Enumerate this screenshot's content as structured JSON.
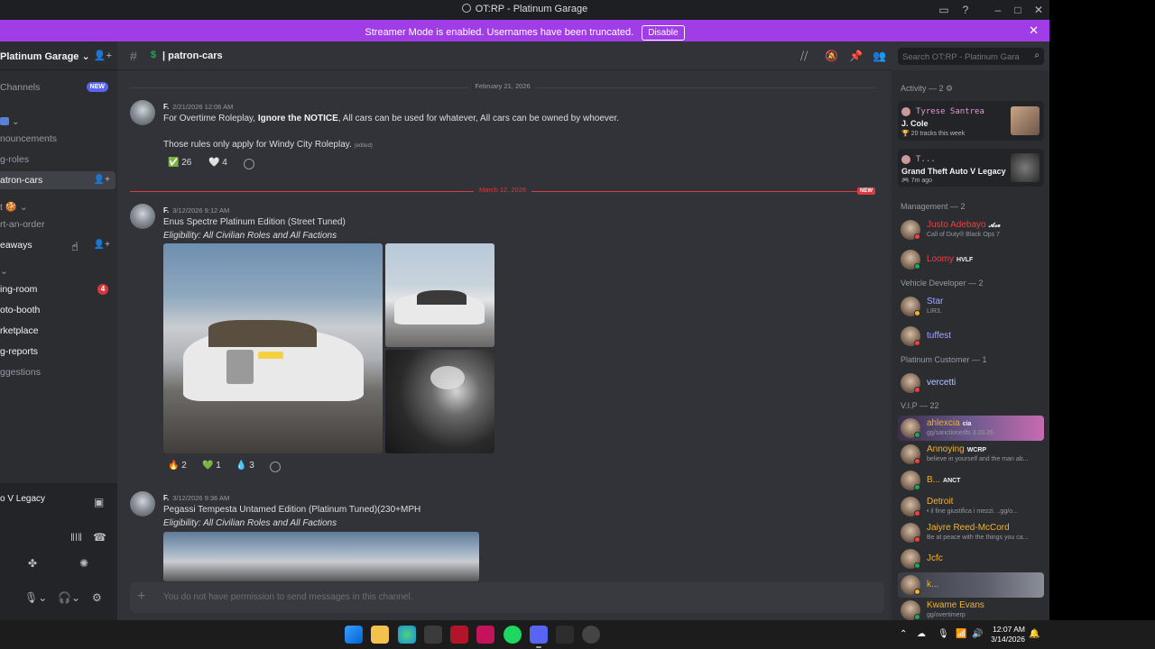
{
  "window": {
    "title": "OT:RP - Platinum Garage"
  },
  "banner": {
    "message": "Streamer Mode is enabled. Usernames have been truncated.",
    "disable_label": "Disable"
  },
  "server": {
    "name": "Platinum Garage"
  },
  "sidebar": {
    "browse_channels": "Channels",
    "new_badge": "NEW",
    "channels": [
      {
        "label": "nouncements"
      },
      {
        "label": "g-roles"
      },
      {
        "label": "atron-cars"
      },
      {
        "label": "rt-an-order"
      },
      {
        "label": "eaways"
      },
      {
        "label": "ing-room",
        "badge": "4"
      },
      {
        "label": "oto-booth"
      },
      {
        "label": "rketplace"
      },
      {
        "label": "g-reports"
      },
      {
        "label": "ggestions"
      }
    ],
    "voice_activity": "o V Legacy"
  },
  "chat": {
    "channel_name": "| patron-cars",
    "search_placeholder": "Search OT:RP - Platinum Garage",
    "composer_placeholder": "You do not have permission to send messages in this channel.",
    "dividers": [
      {
        "label": "February 21, 2026"
      },
      {
        "label": "March 12, 2026",
        "new_tag": "NEW"
      }
    ],
    "messages": [
      {
        "author": "F.",
        "timestamp": "2/21/2026 12:06 AM",
        "line1_pre": "For Overtime Roleplay, ",
        "line1_bold": "Ignore the NOTICE",
        "line1_post": ", All cars can be used for whatever, All cars can be owned by whoever.",
        "line2": "Those rules only apply for Windy City Roleplay.",
        "edited": "(edited)",
        "reactions": [
          {
            "emoji": "✅",
            "count": "26"
          },
          {
            "emoji": "🤍",
            "count": "4"
          }
        ]
      },
      {
        "author": "F.",
        "timestamp": "3/12/2026 9:12 AM",
        "title": "Enus Spectre Platinum Edition (Street Tuned)",
        "subtitle": "Eligibility: All Civilian Roles and All Factions",
        "reactions": [
          {
            "emoji": "🔥",
            "count": "2"
          },
          {
            "emoji": "💚",
            "count": "1"
          },
          {
            "emoji": "💧",
            "count": "3"
          }
        ]
      },
      {
        "author": "F.",
        "timestamp": "3/12/2026 9:36 AM",
        "title": "Pegassi Tempesta Untamed Edition (Platinum Tuned)(230+MPH",
        "subtitle": "Eligibility: All Civilian Roles and All Factions"
      }
    ]
  },
  "members": {
    "activity_header": "Activity — 2",
    "activities": [
      {
        "user": "Tyrese Santrea",
        "title": "J. Cole",
        "sub": "20 tracks this week"
      },
      {
        "user": "T...",
        "title": "Grand Theft Auto V Legacy",
        "sub": "7m ago"
      }
    ],
    "sections": [
      {
        "header": "Management — 2",
        "members": [
          {
            "name": "Justo Adebayo",
            "tag": "𝓐𝓬𝓮",
            "sub": "Call of Duty® Black Ops 7",
            "color": "#f23f43",
            "status": "dnd"
          },
          {
            "name": "Loomy",
            "tag": "HVLF",
            "sub": "",
            "color": "#f23f43",
            "status": "on"
          }
        ]
      },
      {
        "header": "Vehicle Developer — 2",
        "members": [
          {
            "name": "Star",
            "tag": "",
            "sub": "LIR3.",
            "color": "#a3a6ff",
            "status": "idle"
          },
          {
            "name": "tuffest",
            "tag": "",
            "sub": "",
            "color": "#a3a6ff",
            "status": "dnd"
          }
        ]
      },
      {
        "header": "Platinum Customer — 1",
        "members": [
          {
            "name": "vercetti",
            "tag": "",
            "sub": "",
            "color": "#b4c8ff",
            "status": "dnd"
          }
        ]
      },
      {
        "header": "V.I.P — 22",
        "members": [
          {
            "name": "ahlexcia",
            "tag": "cia",
            "sub": "gg/sanctionedls 3.20.26",
            "color": "#f0b232",
            "status": "on"
          },
          {
            "name": "Annoying",
            "tag": "WCRP",
            "sub": "believe in yourself and the man ab...",
            "color": "#f0b232",
            "status": "dnd"
          },
          {
            "name": "B...",
            "tag": "ANCT",
            "sub": "",
            "color": "#f0b232",
            "status": "on"
          },
          {
            "name": "Detroit",
            "tag": "",
            "sub": "• il fine giustifica i mezzi. ..gg/o...",
            "color": "#f0b232",
            "status": "dnd"
          },
          {
            "name": "Jaiyre Reed-McCord",
            "tag": "",
            "sub": "Be at peace with the things you ca...",
            "color": "#f0b232",
            "status": "dnd"
          },
          {
            "name": "Jcfc",
            "tag": "",
            "sub": "",
            "color": "#f0b232",
            "status": "on"
          },
          {
            "name": "k...",
            "tag": "",
            "sub": "",
            "color": "#f0b232",
            "status": "idle"
          },
          {
            "name": "Kwame Evans",
            "tag": "",
            "sub": "gg/overtimerp",
            "color": "#f0b232",
            "status": "on"
          }
        ]
      }
    ]
  },
  "taskbar": {
    "time": "12:07 AM",
    "date": "3/14/2026"
  },
  "colors": {
    "banner": "#a03de6",
    "accent": "#5865f2",
    "mention": "#d83c3e"
  }
}
